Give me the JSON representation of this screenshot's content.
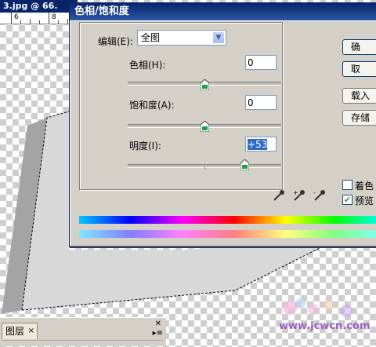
{
  "document": {
    "title_fragment": "3.jpg @ 66.",
    "ruler_numbers": [
      "6",
      "8"
    ]
  },
  "dialog": {
    "title": "色相/饱和度",
    "edit_label": "编辑(E):",
    "edit_value": "全图",
    "hue": {
      "label": "色相(H):",
      "value": "0",
      "level": 0,
      "range": [
        -180,
        180
      ]
    },
    "saturation": {
      "label": "饱和度(A):",
      "value": "0",
      "level": 0,
      "range": [
        -100,
        100
      ]
    },
    "lightness": {
      "label": "明度(I):",
      "value": "+53",
      "level": 53,
      "range": [
        -100,
        100
      ]
    },
    "buttons": {
      "ok": "确",
      "cancel": "取",
      "load": "载入",
      "save": "存储"
    },
    "checkboxes": {
      "colorize": {
        "label": "着色",
        "checked": false
      },
      "preview": {
        "label": "预览",
        "checked": true
      }
    },
    "icons": [
      "eyedropper-icon",
      "eyedropper-plus-icon",
      "eyedropper-minus-icon"
    ]
  },
  "layers_panel": {
    "tab_label": "图层",
    "tab_close": "×"
  },
  "watermark": {
    "text": "www.jcwcn.com"
  }
}
